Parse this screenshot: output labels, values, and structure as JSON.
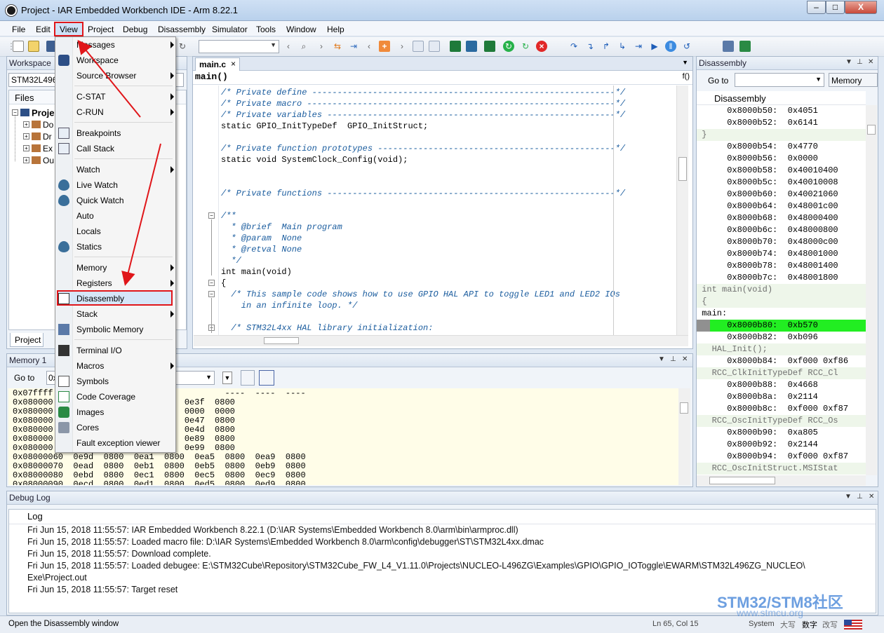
{
  "window": {
    "title": "Project - IAR Embedded Workbench IDE - Arm 8.22.1",
    "min": "–",
    "max": "□",
    "close": "X"
  },
  "menubar": [
    "File",
    "Edit",
    "View",
    "Project",
    "Debug",
    "Disassembly",
    "Simulator",
    "Tools",
    "Window",
    "Help"
  ],
  "workspace": {
    "title": "Workspace",
    "config": "STM32L4962",
    "files_header": "Files",
    "tree": [
      "Proje",
      "Do",
      "Dr",
      "Ex",
      "Ou"
    ],
    "tab": "Project"
  },
  "editor": {
    "tab": "main.c",
    "tab_close": "×",
    "func": "main()",
    "func_btn": "f()",
    "lines": [
      {
        "t": "/* Private define ------------------------------------------------------------*/",
        "c": "cmtb"
      },
      {
        "t": "/* Private macro -------------------------------------------------------------*/",
        "c": "cmtb"
      },
      {
        "t": "/* Private variables ---------------------------------------------------------*/",
        "c": "cmtb"
      },
      {
        "t": "static GPIO_InitTypeDef  GPIO_InitStruct;",
        "c": "kw"
      },
      {
        "t": "",
        "c": "kw"
      },
      {
        "t": "/* Private function prototypes -----------------------------------------------*/",
        "c": "cmtb"
      },
      {
        "t": "static void SystemClock_Config(void);",
        "c": "kw"
      },
      {
        "t": "",
        "c": "kw"
      },
      {
        "t": "",
        "c": "kw"
      },
      {
        "t": "/* Private functions ---------------------------------------------------------*/",
        "c": "cmtb"
      },
      {
        "t": "",
        "c": "kw"
      },
      {
        "t": "/**",
        "c": "cmtb"
      },
      {
        "t": "  * @brief  Main program",
        "c": "cmtb"
      },
      {
        "t": "  * @param  None",
        "c": "cmtb"
      },
      {
        "t": "  * @retval None",
        "c": "cmtb"
      },
      {
        "t": "  */",
        "c": "cmtb"
      },
      {
        "t": "int main(void)",
        "c": "kw"
      },
      {
        "t": "{",
        "c": "kw"
      },
      {
        "t": "  /* This sample code shows how to use GPIO HAL API to toggle LED1 and LED2 IOs",
        "c": "cmtb"
      },
      {
        "t": "    in an infinite loop. */",
        "c": "cmtb"
      },
      {
        "t": "",
        "c": "kw"
      },
      {
        "t": "  /* STM32L4xx HAL library initialization:",
        "c": "cmtb"
      }
    ]
  },
  "memory": {
    "title": "Memory 1",
    "goto": "Go to",
    "goto_value": "0x",
    "lines": [
      "0x07ffff                                  ----  ----  ----",
      "0x080000          00  0e3d  0800  0e3f  0800",
      "0x080000          00  0e45  0800  0000  0000",
      "0x080000          00  0000  0000  0e47  0800",
      "0x080000          00  0e4b  0800  0e4d  0800",
      "0x080000          00  0e85  0800  0e89  0800",
      "0x080000          00  0e95  0800  0e99  0800",
      "0x08000060  0e9d  0800  0ea1  0800  0ea5  0800  0ea9  0800",
      "0x08000070  0ead  0800  0eb1  0800  0eb5  0800  0eb9  0800",
      "0x08000080  0ebd  0800  0ec1  0800  0ec5  0800  0ec9  0800",
      "0x08000090  0ecd  0800  0ed1  0800  0ed5  0800  0ed9  0800"
    ]
  },
  "disassembly": {
    "title": "Disassembly",
    "goto": "Go to",
    "memory_btn": "Memory",
    "header": "Disassembly",
    "lines": [
      {
        "t": "      0x8000b50:  0x4051",
        "c": ""
      },
      {
        "t": "      0x8000b52:  0x6141",
        "c": ""
      },
      {
        "t": " }",
        "c": "dis-src"
      },
      {
        "t": "      0x8000b54:  0x4770",
        "c": ""
      },
      {
        "t": "      0x8000b56:  0x0000",
        "c": ""
      },
      {
        "t": "      0x8000b58:  0x40010400",
        "c": ""
      },
      {
        "t": "      0x8000b5c:  0x40010008",
        "c": ""
      },
      {
        "t": "      0x8000b60:  0x40021060",
        "c": ""
      },
      {
        "t": "      0x8000b64:  0x48001c00",
        "c": ""
      },
      {
        "t": "      0x8000b68:  0x48000400",
        "c": ""
      },
      {
        "t": "      0x8000b6c:  0x48000800",
        "c": ""
      },
      {
        "t": "      0x8000b70:  0x48000c00",
        "c": ""
      },
      {
        "t": "      0x8000b74:  0x48001000",
        "c": ""
      },
      {
        "t": "      0x8000b78:  0x48001400",
        "c": ""
      },
      {
        "t": "      0x8000b7c:  0x48001800",
        "c": ""
      },
      {
        "t": " int main(void)",
        "c": "dis-src"
      },
      {
        "t": " {",
        "c": "dis-src"
      },
      {
        "t": " main:",
        "c": ""
      },
      {
        "t": "      0x8000b80:  0xb570",
        "c": "cur"
      },
      {
        "t": "      0x8000b82:  0xb096",
        "c": ""
      },
      {
        "t": "   HAL_Init();",
        "c": "dis-src"
      },
      {
        "t": "      0x8000b84:  0xf000 0xf86",
        "c": ""
      },
      {
        "t": "   RCC_ClkInitTypeDef RCC_Cl",
        "c": "dis-src"
      },
      {
        "t": "      0x8000b88:  0x4668",
        "c": ""
      },
      {
        "t": "      0x8000b8a:  0x2114",
        "c": ""
      },
      {
        "t": "      0x8000b8c:  0xf000 0xf87",
        "c": ""
      },
      {
        "t": "   RCC_OscInitTypeDef RCC_Os",
        "c": "dis-src"
      },
      {
        "t": "      0x8000b90:  0xa805",
        "c": ""
      },
      {
        "t": "      0x8000b92:  0x2144",
        "c": ""
      },
      {
        "t": "      0x8000b94:  0xf000 0xf87",
        "c": ""
      },
      {
        "t": "   RCC_OscInitStruct.MSIStat",
        "c": "dis-src"
      }
    ]
  },
  "debuglog": {
    "title": "Debug Log",
    "header": "Log",
    "lines": [
      "Fri Jun 15, 2018 11:55:57: IAR Embedded Workbench 8.22.1 (D:\\IAR Systems\\Embedded Workbench 8.0\\arm\\bin\\armproc.dll)",
      "Fri Jun 15, 2018 11:55:57: Loaded macro file: D:\\IAR Systems\\Embedded Workbench 8.0\\arm\\config\\debugger\\ST\\STM32L4xx.dmac",
      "Fri Jun 15, 2018 11:55:57: Download complete.",
      "Fri Jun 15, 2018 11:55:57: Loaded debugee: E:\\STM32Cube\\Repository\\STM32Cube_FW_L4_V1.11.0\\Projects\\NUCLEO-L496ZG\\Examples\\GPIO\\GPIO_IOToggle\\EWARM\\STM32L496ZG_NUCLEO\\",
      "Exe\\Project.out",
      "Fri Jun 15, 2018 11:55:57: Target reset"
    ]
  },
  "status": {
    "message": "Open the Disassembly window",
    "position": "Ln 65, Col 15",
    "system": "System",
    "ime1": "大写",
    "ime2": "数字",
    "ime3": "改写",
    "watermark1": "STM32/STM8社区",
    "watermark2": "www.stmcu.org"
  },
  "view_menu": [
    {
      "label": "Messages",
      "sub": true,
      "icon": ""
    },
    {
      "label": "Workspace",
      "sub": false,
      "icon": "workspace-icon"
    },
    {
      "label": "Source Browser",
      "sub": true,
      "icon": ""
    },
    {
      "sep": true
    },
    {
      "label": "C-STAT",
      "sub": true,
      "icon": ""
    },
    {
      "label": "C-RUN",
      "sub": true,
      "icon": ""
    },
    {
      "sep": true
    },
    {
      "label": "Breakpoints",
      "sub": false,
      "icon": "breakpoints-icon"
    },
    {
      "label": "Call Stack",
      "sub": false,
      "icon": "call-stack-icon"
    },
    {
      "sep": true
    },
    {
      "label": "Watch",
      "sub": true,
      "icon": ""
    },
    {
      "label": "Live Watch",
      "sub": false,
      "icon": "eye-icon"
    },
    {
      "label": "Quick Watch",
      "sub": false,
      "icon": "eye-icon"
    },
    {
      "label": "Auto",
      "sub": false,
      "icon": ""
    },
    {
      "label": "Locals",
      "sub": false,
      "icon": ""
    },
    {
      "label": "Statics",
      "sub": false,
      "icon": "eye-icon"
    },
    {
      "sep": true
    },
    {
      "label": "Memory",
      "sub": true,
      "icon": ""
    },
    {
      "label": "Registers",
      "sub": true,
      "icon": ""
    },
    {
      "label": "Disassembly",
      "sub": false,
      "icon": "disassembly-icon"
    },
    {
      "label": "Stack",
      "sub": true,
      "icon": ""
    },
    {
      "label": "Symbolic Memory",
      "sub": false,
      "icon": "symbolic-memory-icon"
    },
    {
      "sep": true
    },
    {
      "label": "Terminal I/O",
      "sub": false,
      "icon": "terminal-icon"
    },
    {
      "label": "Macros",
      "sub": true,
      "icon": ""
    },
    {
      "label": "Symbols",
      "sub": false,
      "icon": "symbols-icon"
    },
    {
      "label": "Code Coverage",
      "sub": false,
      "icon": "code-coverage-icon"
    },
    {
      "label": "Images",
      "sub": false,
      "icon": "images-icon"
    },
    {
      "label": "Cores",
      "sub": false,
      "icon": "cores-icon"
    },
    {
      "label": "Fault exception viewer",
      "sub": false,
      "icon": ""
    }
  ],
  "colors": {
    "highlight_red": "#e0161a",
    "current_line": "#22ee22",
    "accent": "#3c7fd6"
  }
}
